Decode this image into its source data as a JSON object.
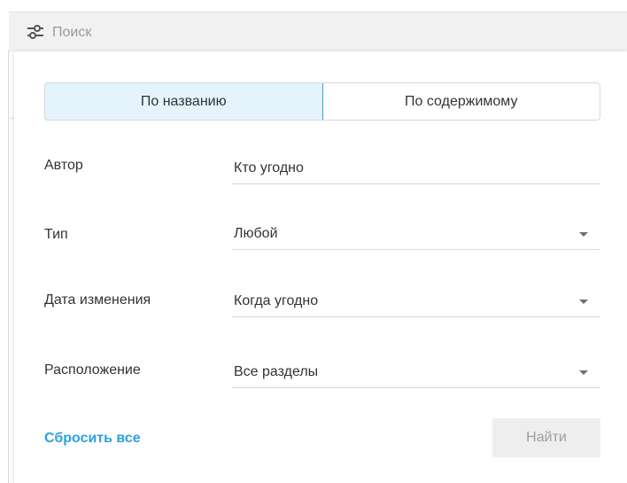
{
  "header": {
    "icon": "sliders-icon",
    "title": "Поиск"
  },
  "tabs": [
    {
      "label": "По названию",
      "active": true
    },
    {
      "label": "По содержимому",
      "active": false
    }
  ],
  "fields": {
    "author": {
      "label": "Автор",
      "value": "Кто угодно"
    },
    "type": {
      "label": "Тип",
      "value": "Любой",
      "icon": "caret-down-icon"
    },
    "modified": {
      "label": "Дата изменения",
      "value": "Когда угодно",
      "icon": "caret-down-icon"
    },
    "location": {
      "label": "Расположение",
      "value": "Все разделы",
      "icon": "caret-down-icon"
    }
  },
  "actions": {
    "reset_label": "Сбросить все",
    "find_label": "Найти"
  },
  "colors": {
    "accent": "#2aa2dc",
    "active_tab_bg": "#e5f4fc",
    "header_bg": "#f1f1f1",
    "disabled_button_bg": "#eeeeee",
    "disabled_button_text": "#9e9e9e"
  }
}
